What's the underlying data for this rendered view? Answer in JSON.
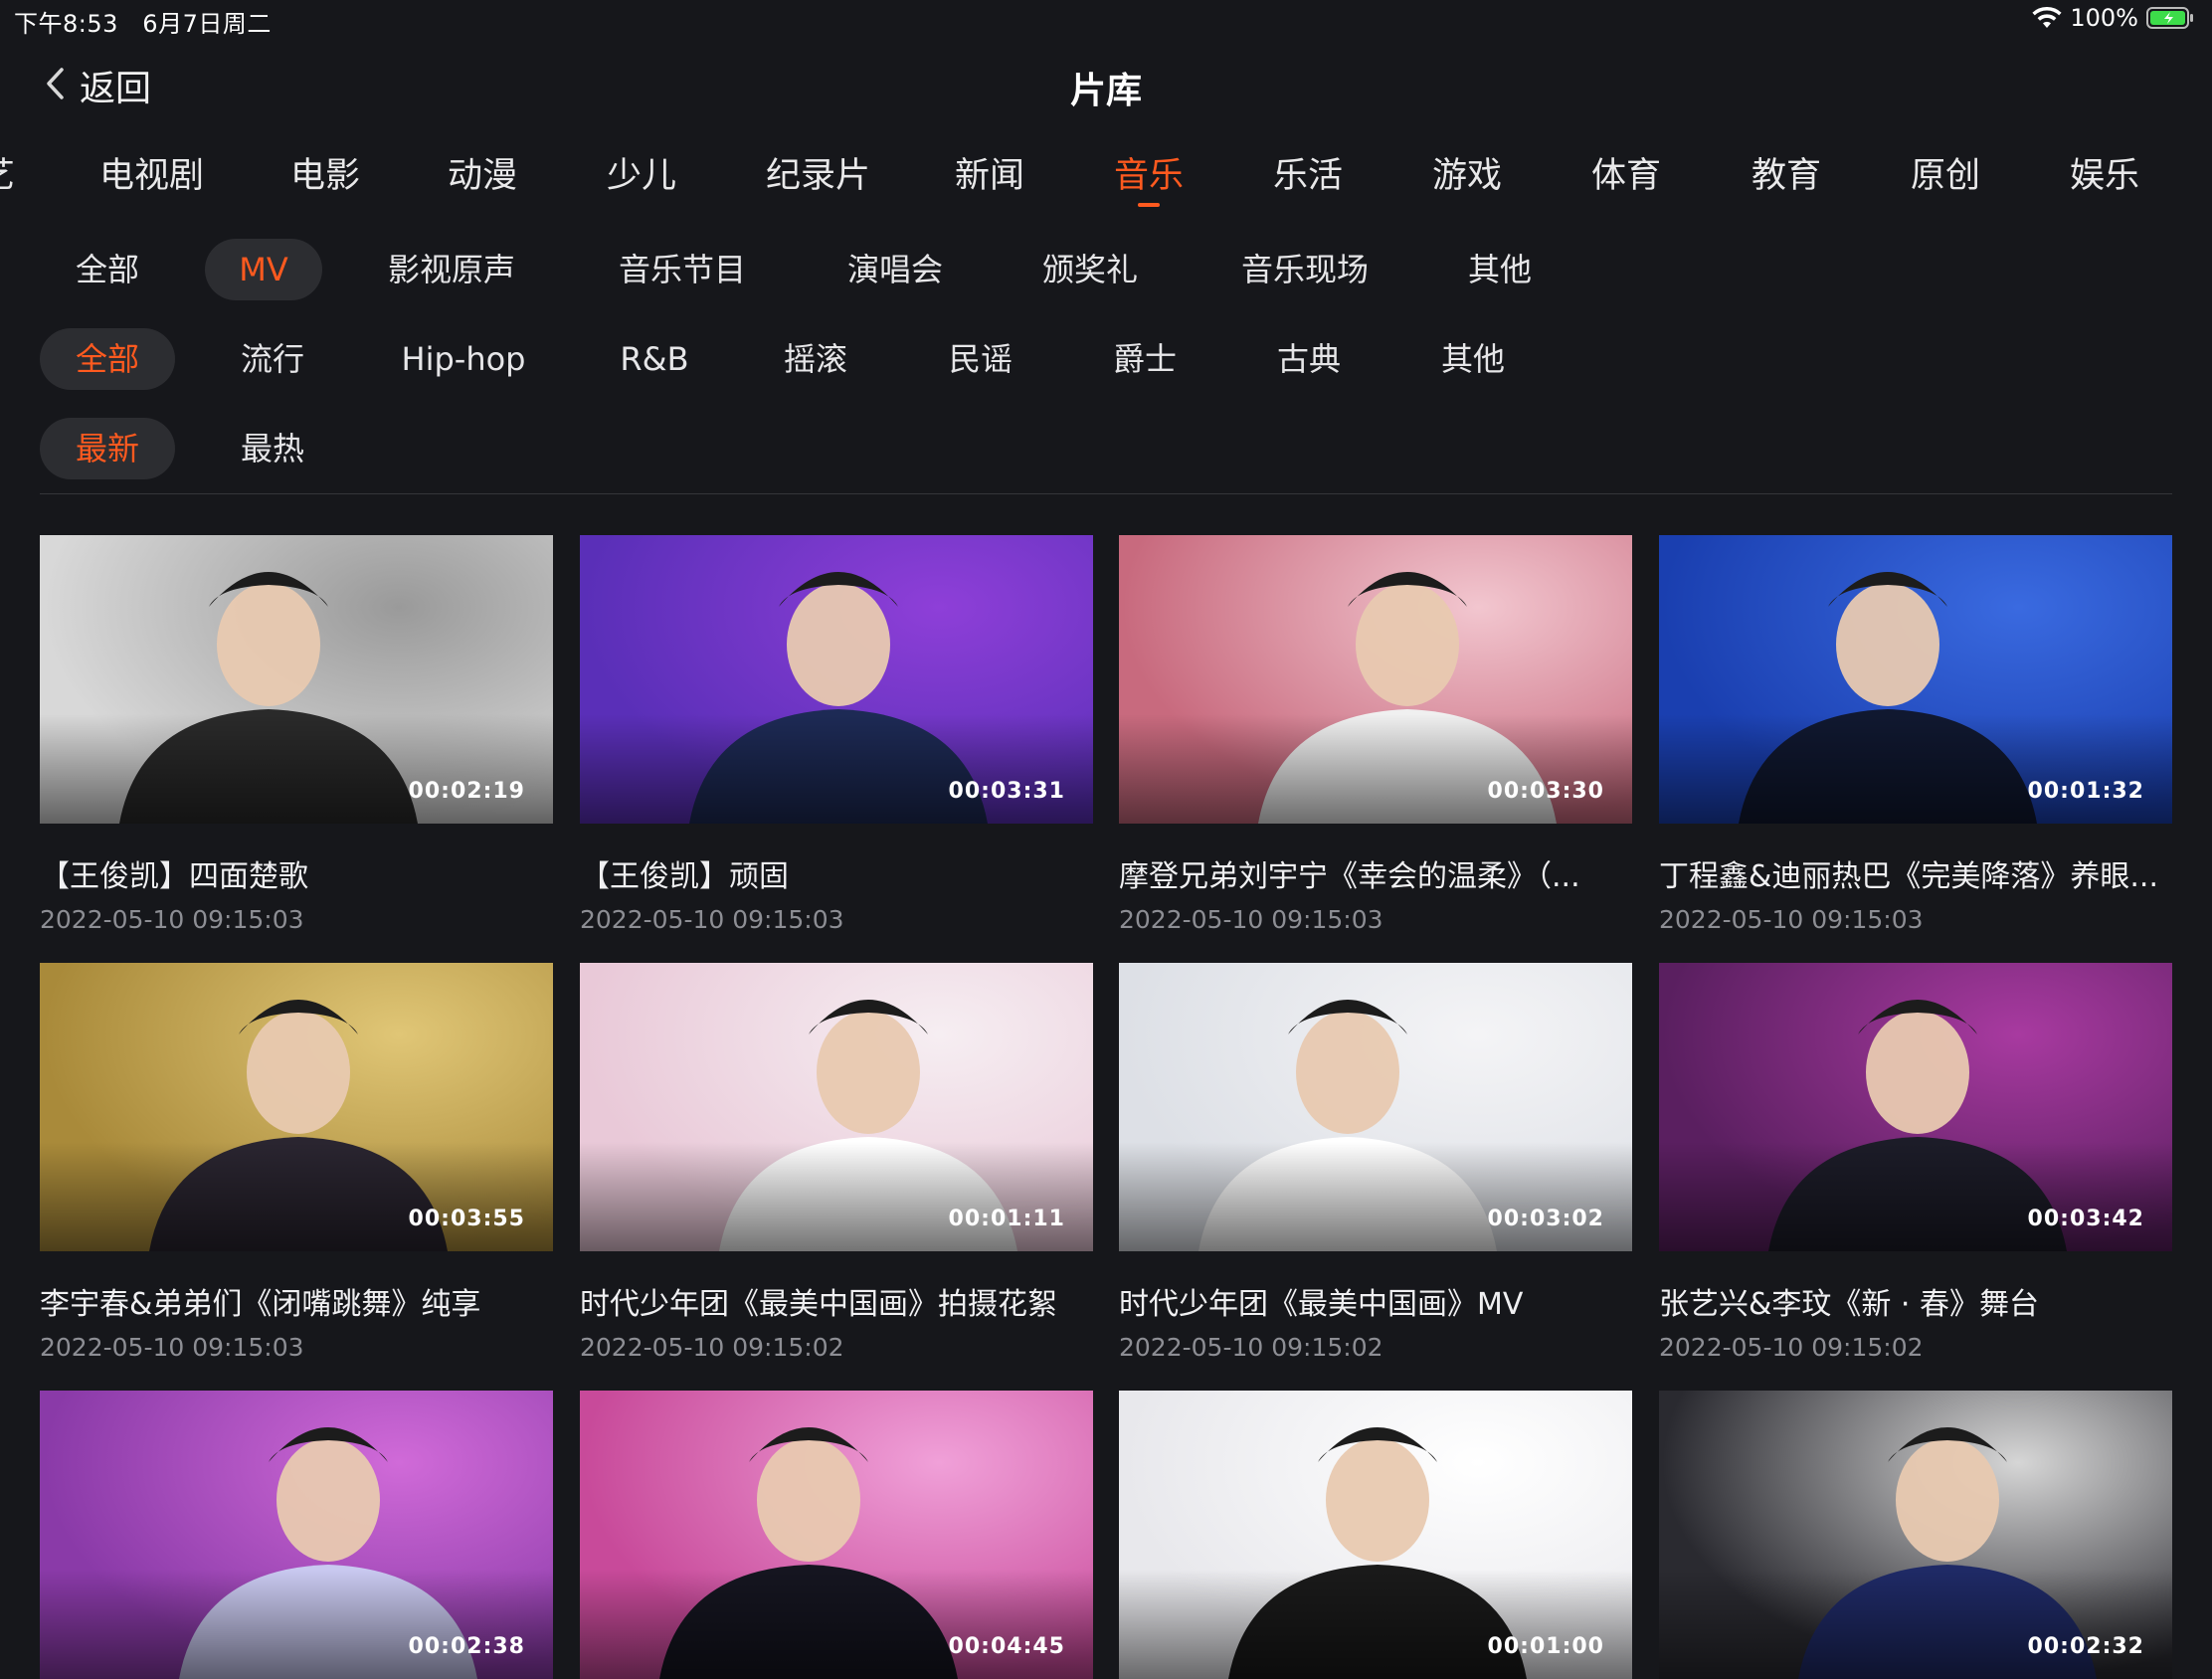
{
  "status_bar": {
    "time": "下午8:53",
    "date": "6月7日周二",
    "battery": "100%"
  },
  "header": {
    "back_label": "返回",
    "title": "片库"
  },
  "category_tabs": [
    {
      "label": "艺",
      "active": false
    },
    {
      "label": "电视剧",
      "active": false
    },
    {
      "label": "电影",
      "active": false
    },
    {
      "label": "动漫",
      "active": false
    },
    {
      "label": "少儿",
      "active": false
    },
    {
      "label": "纪录片",
      "active": false
    },
    {
      "label": "新闻",
      "active": false
    },
    {
      "label": "音乐",
      "active": true
    },
    {
      "label": "乐活",
      "active": false
    },
    {
      "label": "游戏",
      "active": false
    },
    {
      "label": "体育",
      "active": false
    },
    {
      "label": "教育",
      "active": false
    },
    {
      "label": "原创",
      "active": false
    },
    {
      "label": "娱乐",
      "active": false
    }
  ],
  "filter_type": [
    {
      "label": "全部",
      "active": false
    },
    {
      "label": "MV",
      "active": true
    },
    {
      "label": "影视原声",
      "active": false
    },
    {
      "label": "音乐节目",
      "active": false
    },
    {
      "label": "演唱会",
      "active": false
    },
    {
      "label": "颁奖礼",
      "active": false
    },
    {
      "label": "音乐现场",
      "active": false
    },
    {
      "label": "其他",
      "active": false
    }
  ],
  "filter_genre": [
    {
      "label": "全部",
      "active": true
    },
    {
      "label": "流行",
      "active": false
    },
    {
      "label": "Hip-hop",
      "active": false
    },
    {
      "label": "R&B",
      "active": false
    },
    {
      "label": "摇滚",
      "active": false
    },
    {
      "label": "民谣",
      "active": false
    },
    {
      "label": "爵士",
      "active": false
    },
    {
      "label": "古典",
      "active": false
    },
    {
      "label": "其他",
      "active": false
    }
  ],
  "filter_sort": [
    {
      "label": "最新",
      "active": true
    },
    {
      "label": "最热",
      "active": false
    }
  ],
  "videos": [
    {
      "title": "【王俊凯】四面楚歌",
      "date": "2022-05-10 09:15:03",
      "duration": "00:02:19",
      "bg": "#d8d8d8",
      "bg2": "#9a9a9a",
      "figure": "#2a2a2a"
    },
    {
      "title": "【王俊凯】顽固",
      "date": "2022-05-10 09:15:03",
      "duration": "00:03:31",
      "bg": "#5a2fb8",
      "bg2": "#8e3fd8",
      "figure": "#1d2a55"
    },
    {
      "title": "摩登兄弟刘宇宁《幸会的温柔》（...",
      "date": "2022-05-10 09:15:03",
      "duration": "00:03:30",
      "bg": "#c86a7e",
      "bg2": "#f2c6cf",
      "figure": "#f0f0f0"
    },
    {
      "title": "丁程鑫&迪丽热巴《完美降落》养眼...",
      "date": "2022-05-10 09:15:03",
      "duration": "00:01:32",
      "bg": "#1a3fb0",
      "bg2": "#3a6ae0",
      "figure": "#101830"
    },
    {
      "title": "李宇春&弟弟们《闭嘴跳舞》纯享",
      "date": "2022-05-10 09:15:03",
      "duration": "00:03:55",
      "bg": "#a98a3a",
      "bg2": "#e0c676",
      "figure": "#2a2530"
    },
    {
      "title": "时代少年团《最美中国画》拍摄花絮",
      "date": "2022-05-10 09:15:02",
      "duration": "00:01:11",
      "bg": "#e9c9d8",
      "bg2": "#f6eef2",
      "figure": "#ffffff"
    },
    {
      "title": "时代少年团《最美中国画》MV",
      "date": "2022-05-10 09:15:02",
      "duration": "00:03:02",
      "bg": "#dde0e6",
      "bg2": "#f4f4f6",
      "figure": "#ffffff"
    },
    {
      "title": "张艺兴&李玟《新 · 春》舞台",
      "date": "2022-05-10 09:15:02",
      "duration": "00:03:42",
      "bg": "#5a1f60",
      "bg2": "#a83aa0",
      "figure": "#1c1c28"
    },
    {
      "title": "",
      "date": "",
      "duration": "00:02:38",
      "bg": "#8a3aa8",
      "bg2": "#d06ad8",
      "figure": "#c9c9f0"
    },
    {
      "title": "",
      "date": "",
      "duration": "00:04:45",
      "bg": "#c84a9a",
      "bg2": "#f0a0d8",
      "figure": "#151520"
    },
    {
      "title": "",
      "date": "",
      "duration": "00:01:00",
      "bg": "#e8e8ec",
      "bg2": "#ffffff",
      "figure": "#1a1a1a"
    },
    {
      "title": "",
      "date": "",
      "duration": "00:02:32",
      "bg": "#2a2a30",
      "bg2": "#d6d6d6",
      "figure": "#1f2a66"
    }
  ]
}
